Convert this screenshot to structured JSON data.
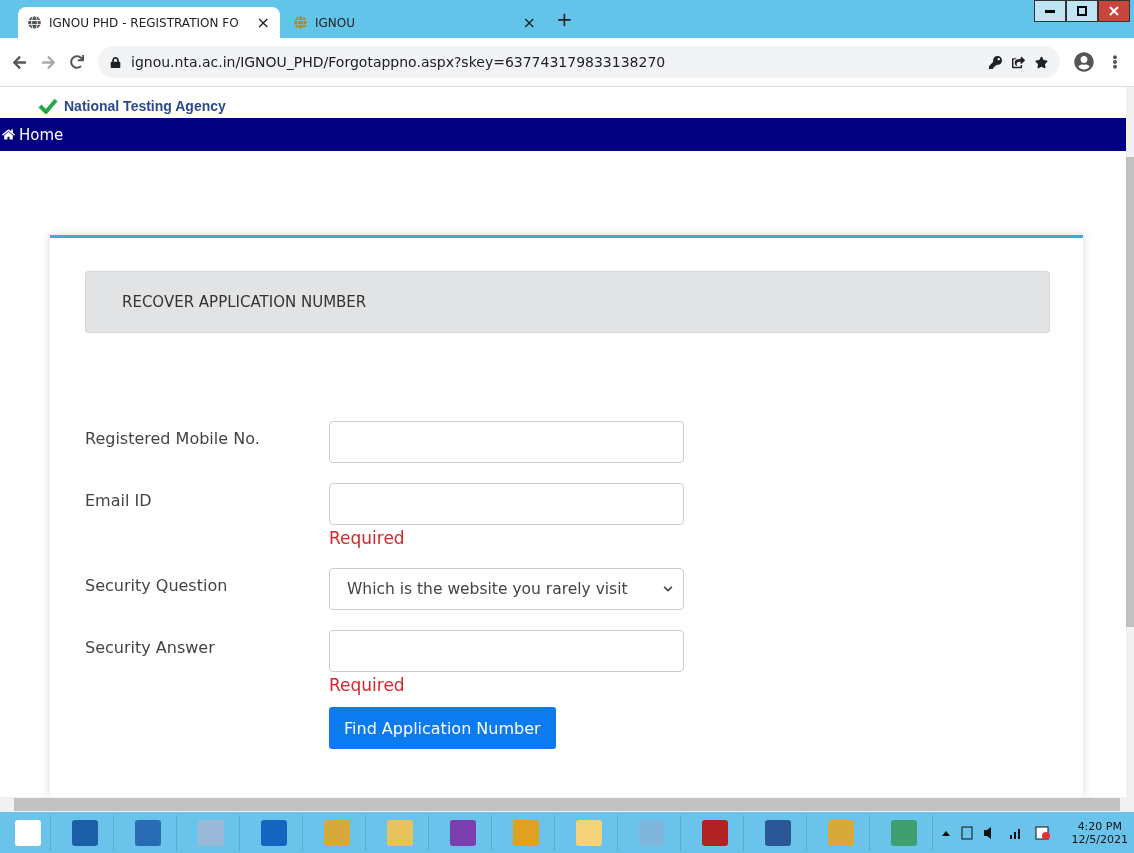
{
  "browser": {
    "tabs": [
      {
        "title": "IGNOU PHD - REGISTRATION FO",
        "selected": true,
        "close": "×"
      },
      {
        "title": "IGNOU",
        "selected": false,
        "close": "×"
      }
    ],
    "new_tab": "+",
    "url": "ignou.nta.ac.in/IGNOU_PHD/Forgotappno.aspx?skey=637743179833138270"
  },
  "header": {
    "brand": "National Testing Agency"
  },
  "nav": {
    "home": "Home"
  },
  "form": {
    "heading": "RECOVER APPLICATION NUMBER",
    "fields": [
      {
        "label": "Registered Mobile No.",
        "kind": "text"
      },
      {
        "label": "Email ID",
        "kind": "text",
        "error": "Required"
      },
      {
        "label": "Security Question",
        "kind": "select",
        "value": "Which is the website you rarely visit"
      },
      {
        "label": "Security Answer",
        "kind": "text",
        "error": "Required"
      }
    ],
    "button": "Find Application Number"
  },
  "taskbar": {
    "time": "4:20 PM",
    "date": "12/5/2021"
  }
}
